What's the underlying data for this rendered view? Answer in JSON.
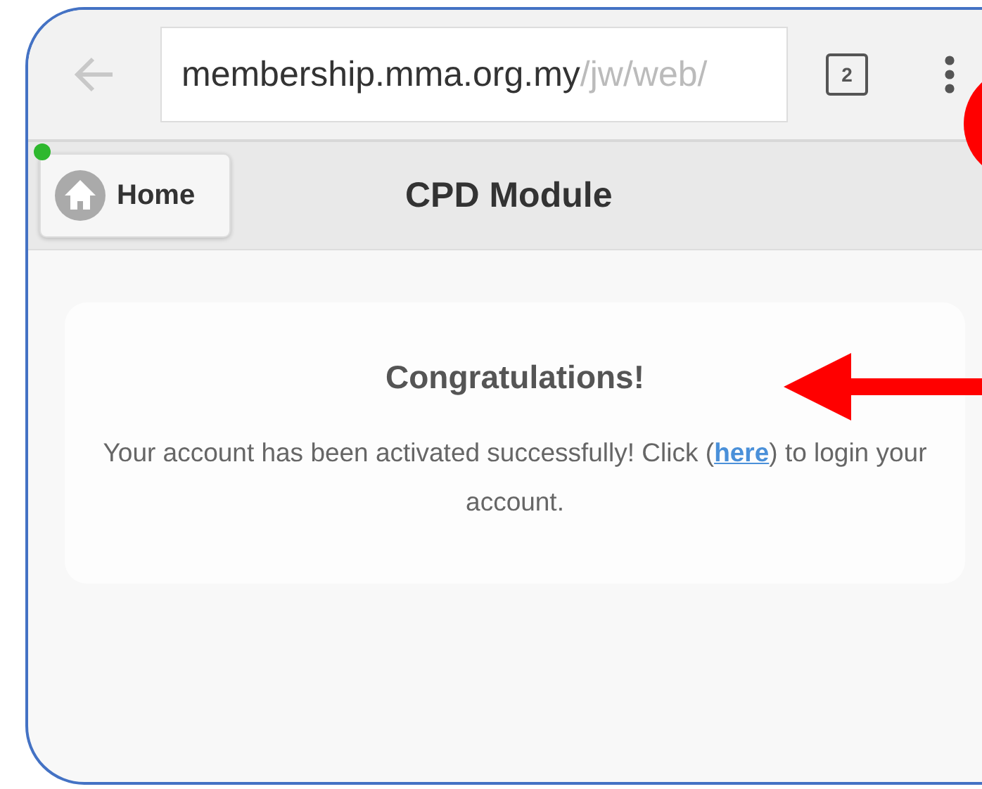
{
  "browser": {
    "url_host": "membership.mma.org.my",
    "url_path": "/jw/web/",
    "tab_count": "2"
  },
  "header": {
    "home_button": "Home",
    "title": "CPD Module"
  },
  "message": {
    "heading": "Congratulations!",
    "text_before": "Your account has been activated successfully! Click (",
    "link": "here",
    "text_after": ") to login your account."
  }
}
